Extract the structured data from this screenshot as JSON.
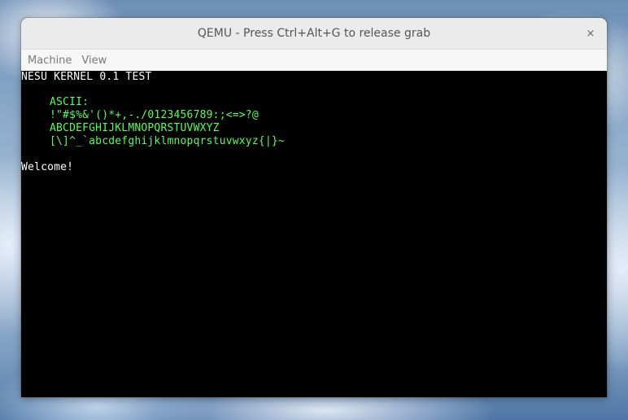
{
  "window": {
    "title": "QEMU - Press Ctrl+Alt+G to release grab",
    "close_glyph": "×"
  },
  "menu": {
    "items": [
      "Machine",
      "View"
    ]
  },
  "console": {
    "header": "NESU KERNEL 0.1 TEST",
    "ascii_label": "ASCII:",
    "ascii_line1": "!\"#$%&'()*+,-./0123456789:;<=>?@",
    "ascii_line2": "ABCDEFGHIJKLMNOPQRSTUVWXYZ",
    "ascii_line3": "[\\]^_`abcdefghijklmnopqrstuvwxyz{|}~",
    "welcome": "Welcome!",
    "colors": {
      "background": "#000000",
      "white_text": "#ffffff",
      "green_text": "#55ff55"
    }
  }
}
